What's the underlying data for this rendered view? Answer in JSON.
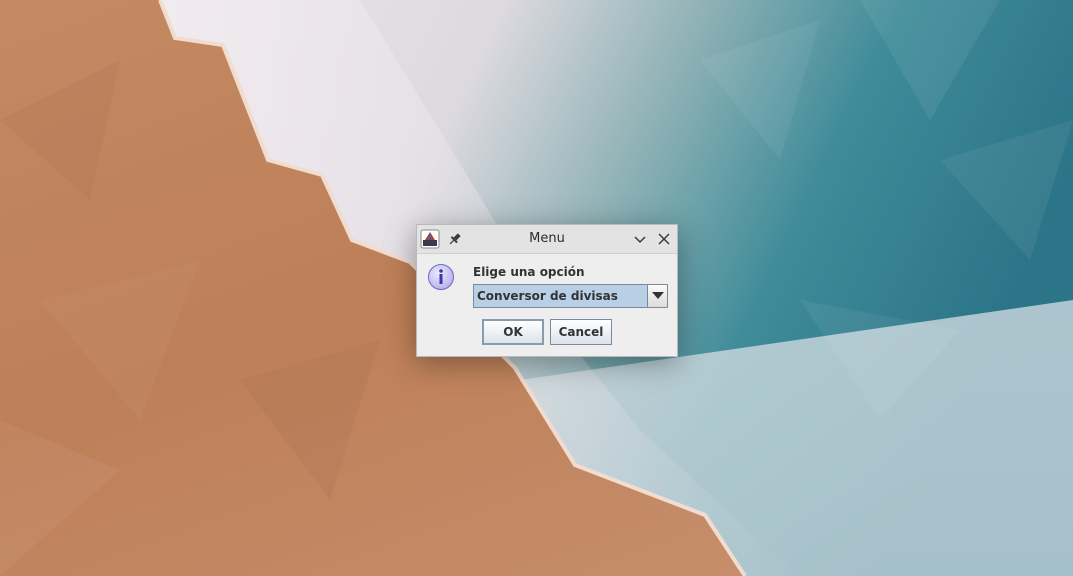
{
  "dialog": {
    "title": "Menu",
    "prompt": "Elige una opción",
    "selected_option": "Conversor de divisas",
    "ok_label": "OK",
    "cancel_label": "Cancel"
  },
  "icons": {
    "app": "java-app-icon",
    "pin": "pin-icon",
    "minimize": "chevron-down-icon",
    "close": "close-icon",
    "message": "info-icon",
    "dropdown": "dropdown-arrow-icon"
  },
  "colors": {
    "dialog_background": "#eeeeee",
    "titlebar_background": "#e3e3e3",
    "combo_selected_background": "#b8cfe5",
    "info_icon_fill": "#c7c3ef",
    "info_icon_letter": "#3d36a8"
  }
}
